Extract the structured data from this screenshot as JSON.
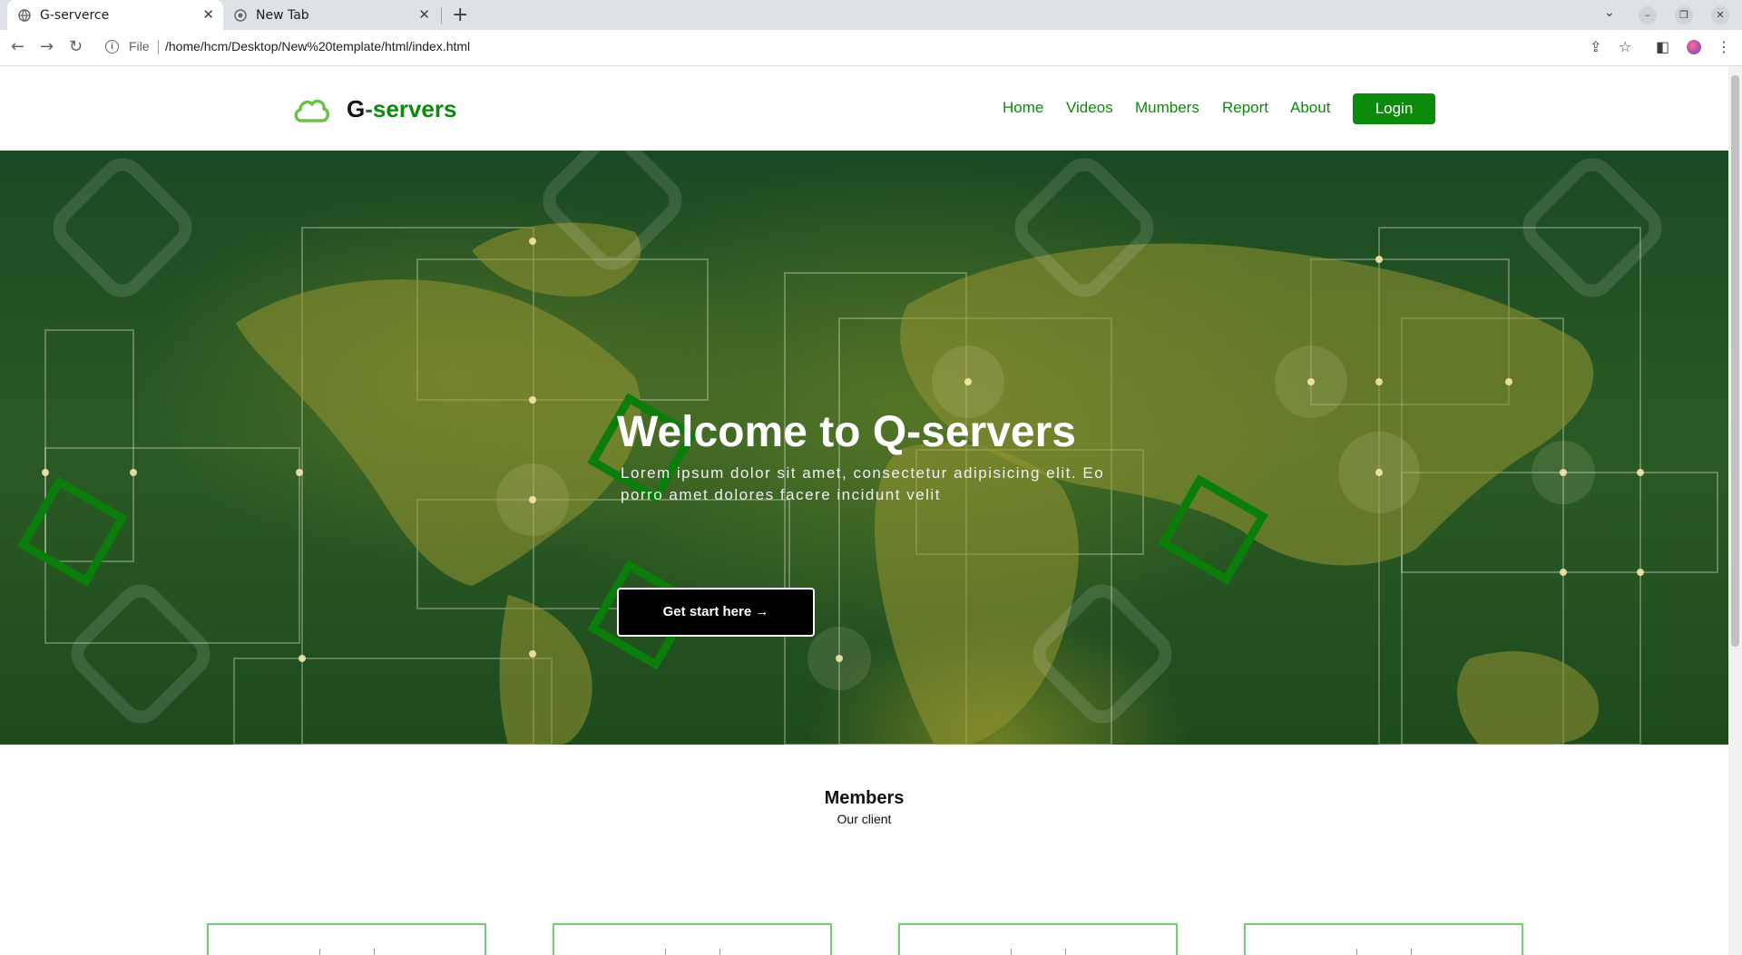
{
  "browser": {
    "tabs": [
      {
        "title": "G-serverce",
        "active": true
      },
      {
        "title": "New Tab",
        "active": false
      }
    ],
    "address": {
      "scheme": "File",
      "url": "/home/hcm/Desktop/New%20template/html/index.html"
    }
  },
  "site": {
    "logo": {
      "prefix": "G",
      "dash": "-",
      "rest": "servers"
    },
    "nav": [
      "Home",
      "Videos",
      "Mumbers",
      "Report",
      "About"
    ],
    "login_label": "Login"
  },
  "hero": {
    "title": "Welcome to Q-servers",
    "text": "Lorem ipsum dolor sit amet, consectetur adipisicing elit. Eo porro amet dolores facere incidunt velit",
    "button_label": "Get start here →"
  },
  "members": {
    "title": "Members",
    "subtitle": "Our client"
  },
  "colors": {
    "brand_green": "#0b8a0b",
    "hero_overlay": "#1e4a1e"
  }
}
